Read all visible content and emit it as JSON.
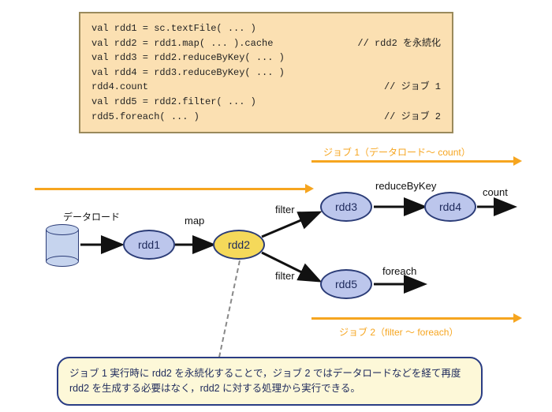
{
  "code": {
    "lines": [
      {
        "left": "val rdd1 = sc.textFile( ... )",
        "right": ""
      },
      {
        "left": "val rdd2 = rdd1.map( ... ).cache",
        "right": "// rdd2 を永続化"
      },
      {
        "left": "val rdd3 = rdd2.reduceByKey( ... )",
        "right": ""
      },
      {
        "left": "val rdd4 = rdd3.reduceByKey( ... )",
        "right": ""
      },
      {
        "left": "rdd4.count",
        "right": "// ジョブ 1"
      },
      {
        "left": "val rdd5 = rdd2.filter( ... )",
        "right": ""
      },
      {
        "left": "rdd5.foreach( ... )",
        "right": "// ジョブ 2"
      }
    ]
  },
  "diagram": {
    "nodes": {
      "rdd1": "rdd1",
      "rdd2": "rdd2",
      "rdd3": "rdd3",
      "rdd4": "rdd4",
      "rdd5": "rdd5"
    },
    "labels": {
      "load": "データロード",
      "map": "map",
      "filter_top": "filter",
      "filter_bot": "filter",
      "reduceByKey": "reduceByKey",
      "count": "count",
      "foreach": "foreach"
    },
    "jobs": {
      "job1": "ジョブ 1（データロード～ count）",
      "job2": "ジョブ 2（filter ～ foreach）"
    }
  },
  "explain": "ジョブ 1 実行時に rdd2 を永続化することで，ジョブ 2 ではデータロードなどを経て再度 rdd2 を生成する必要はなく，rdd2 に対する処理から実行できる。"
}
